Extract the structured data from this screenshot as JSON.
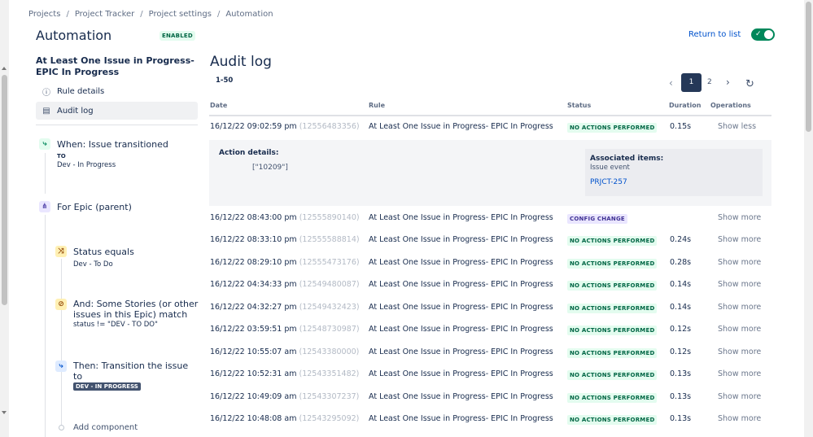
{
  "breadcrumbs": [
    "Projects",
    "Project Tracker",
    "Project settings",
    "Automation"
  ],
  "header": {
    "title": "Automation",
    "badge": "ENABLED",
    "return_label": "Return to list",
    "toggle_on": true
  },
  "sidebar": {
    "rule_name": "At Least One Issue in Progress- EPIC In Progress",
    "items": [
      {
        "label": "Rule details",
        "icon": "info-icon"
      },
      {
        "label": "Audit log",
        "icon": "document-icon"
      }
    ]
  },
  "components": {
    "trigger": {
      "title": "When: Issue transitioned",
      "to_label": "TO",
      "value": "Dev - In Progress"
    },
    "branch": {
      "title": "For Epic (parent)"
    },
    "cond1": {
      "title": "Status equals",
      "value": "Dev - To Do"
    },
    "cond2": {
      "title_line1": "And: Some Stories (or other",
      "title_line2": "issues in this Epic) match",
      "value": "status != \"DEV - TO DO\""
    },
    "action": {
      "title_line1": "Then: Transition the issue",
      "title_line2": "to",
      "value": "DEV - IN PROGRESS"
    },
    "add": "Add component"
  },
  "audit": {
    "title": "Audit log",
    "range": "1-50",
    "pages": [
      "1",
      "2"
    ],
    "columns": {
      "date": "Date",
      "rule": "Rule",
      "status": "Status",
      "duration": "Duration",
      "operations": "Operations"
    },
    "rows": [
      {
        "date": "16/12/22 09:02:59 pm",
        "id": "(12556483356)",
        "rule": "At Least One Issue in Progress- EPIC In Progress",
        "status": "NO ACTIONS PERFORMED",
        "duration": "0.15s",
        "ops": "Show less"
      },
      {
        "date": "16/12/22 08:43:00 pm",
        "id": "(12555890140)",
        "rule": "At Least One Issue in Progress- EPIC In Progress",
        "status": "CONFIG CHANGE",
        "duration": "",
        "ops": "Show more"
      },
      {
        "date": "16/12/22 08:33:10 pm",
        "id": "(12555588814)",
        "rule": "At Least One Issue in Progress- EPIC In Progress",
        "status": "NO ACTIONS PERFORMED",
        "duration": "0.24s",
        "ops": "Show more"
      },
      {
        "date": "16/12/22 08:29:10 pm",
        "id": "(12555473176)",
        "rule": "At Least One Issue in Progress- EPIC In Progress",
        "status": "NO ACTIONS PERFORMED",
        "duration": "0.28s",
        "ops": "Show more"
      },
      {
        "date": "16/12/22 04:34:33 pm",
        "id": "(12549480087)",
        "rule": "At Least One Issue in Progress- EPIC In Progress",
        "status": "NO ACTIONS PERFORMED",
        "duration": "0.14s",
        "ops": "Show more"
      },
      {
        "date": "16/12/22 04:32:27 pm",
        "id": "(12549432423)",
        "rule": "At Least One Issue in Progress- EPIC In Progress",
        "status": "NO ACTIONS PERFORMED",
        "duration": "0.14s",
        "ops": "Show more"
      },
      {
        "date": "16/12/22 03:59:51 pm",
        "id": "(12548730987)",
        "rule": "At Least One Issue in Progress- EPIC In Progress",
        "status": "NO ACTIONS PERFORMED",
        "duration": "0.12s",
        "ops": "Show more"
      },
      {
        "date": "16/12/22 10:55:07 am",
        "id": "(12543380000)",
        "rule": "At Least One Issue in Progress- EPIC In Progress",
        "status": "NO ACTIONS PERFORMED",
        "duration": "0.12s",
        "ops": "Show more"
      },
      {
        "date": "16/12/22 10:52:31 am",
        "id": "(12543351482)",
        "rule": "At Least One Issue in Progress- EPIC In Progress",
        "status": "NO ACTIONS PERFORMED",
        "duration": "0.13s",
        "ops": "Show more"
      },
      {
        "date": "16/12/22 10:49:09 am",
        "id": "(12543307237)",
        "rule": "At Least One Issue in Progress- EPIC In Progress",
        "status": "NO ACTIONS PERFORMED",
        "duration": "0.13s",
        "ops": "Show more"
      },
      {
        "date": "16/12/22 10:48:08 am",
        "id": "(12543295092)",
        "rule": "At Least One Issue in Progress- EPIC In Progress",
        "status": "NO ACTIONS PERFORMED",
        "duration": "0.13s",
        "ops": "Show more"
      }
    ],
    "details": {
      "action_label": "Action details:",
      "action_value": "[\"10209\"]",
      "assoc_label": "Associated items:",
      "assoc_event": "Issue event",
      "assoc_link": "PRJCT-257"
    }
  },
  "colors": {
    "accent": "#0052cc",
    "success": "#00875a",
    "nav_dark": "#253858"
  }
}
